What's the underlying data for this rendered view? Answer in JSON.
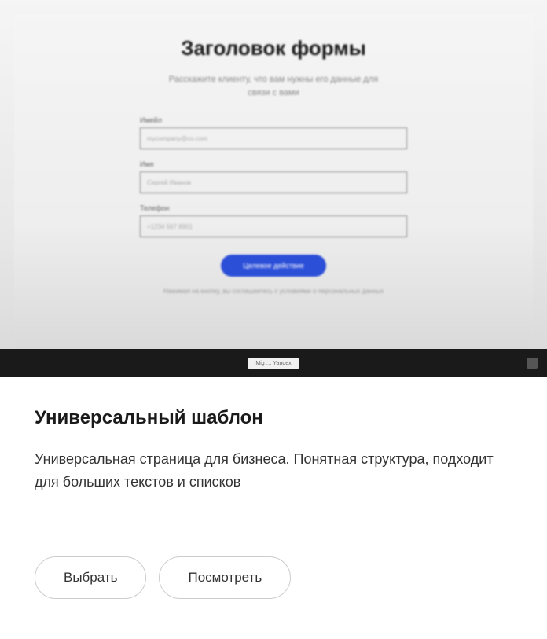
{
  "preview": {
    "form_title": "Заголовок формы",
    "form_subtitle": "Расскажите клиенту, что вам нужны его данные для связи с вами",
    "fields": [
      {
        "label": "Имейл",
        "placeholder": "mycompany@co.com"
      },
      {
        "label": "Имя",
        "placeholder": "Сергей Иванов"
      },
      {
        "label": "Телефон",
        "placeholder": "+1234 567 8901"
      }
    ],
    "submit_label": "Целевое действие",
    "footnote": "Нажимая на кнопку, вы соглашаетесь с условиями о персональных данных",
    "bottom_badge": "Mig … Yandex"
  },
  "template": {
    "title": "Универсальный шаблон",
    "description": "Универсальная страница для бизнеса. Понятная структура, подходит для больших текстов и списков"
  },
  "buttons": {
    "select": "Выбрать",
    "view": "Посмотреть"
  }
}
